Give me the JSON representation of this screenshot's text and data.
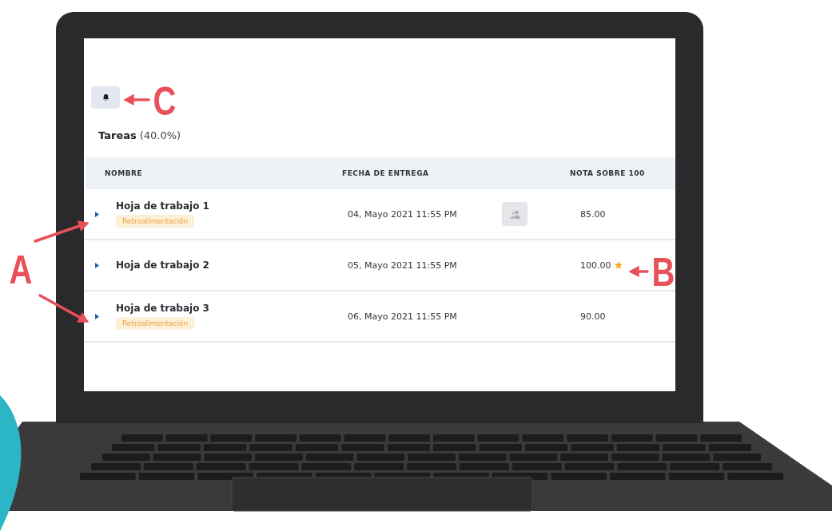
{
  "section": {
    "title": "Tareas",
    "percent": "(40.0%)"
  },
  "columns": [
    "NOMBRE",
    "FECHA DE ENTREGA",
    "NOTA SOBRE 100"
  ],
  "rows": [
    {
      "name": "Hoja de trabajo 1",
      "tag": "Retroalimentación",
      "date": "04, Mayo 2021 11:55 PM",
      "group_icon": true,
      "grade": "85.00",
      "starred": false
    },
    {
      "name": "Hoja de trabajo 2",
      "date": "05, Mayo 2021 11:55 PM",
      "group_icon": false,
      "grade": "100.00",
      "starred": true
    },
    {
      "name": "Hoja de trabajo 3",
      "tag": "Retroalimentación",
      "date": "06, Mayo 2021 11:55 PM",
      "group_icon": false,
      "grade": "90.00",
      "starred": false
    }
  ],
  "annotations": [
    {
      "letter": "A",
      "kind": "expand"
    },
    {
      "letter": "B",
      "kind": "star"
    },
    {
      "letter": "C",
      "kind": "bell"
    }
  ]
}
